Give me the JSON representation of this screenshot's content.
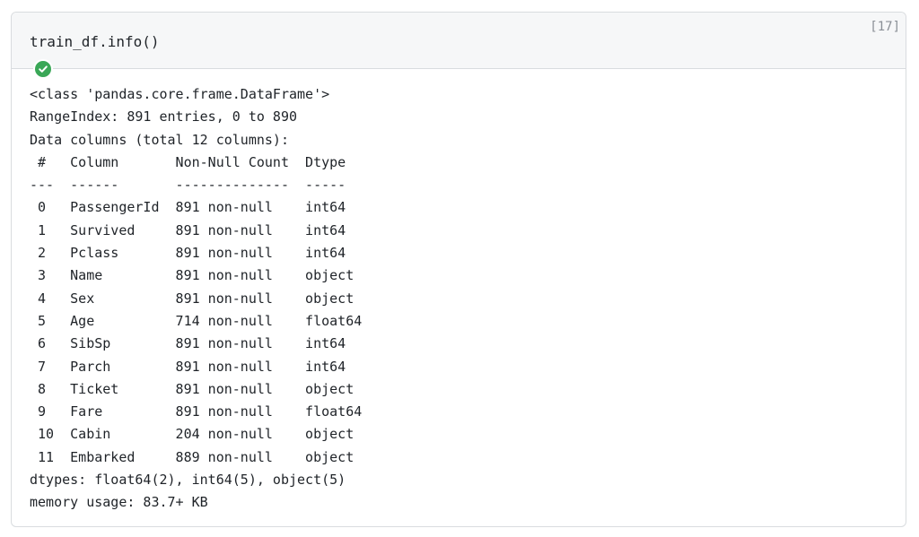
{
  "cell": {
    "execution_count": "[17]",
    "code": "train_df.info()",
    "status": "success",
    "status_icon": "check-circle-icon",
    "status_color": "#3aa757"
  },
  "output": {
    "lines": [
      "<class 'pandas.core.frame.DataFrame'>",
      "RangeIndex: 891 entries, 0 to 890",
      "Data columns (total 12 columns):",
      " #   Column       Non-Null Count  Dtype  ",
      "---  ------       --------------  -----  ",
      " 0   PassengerId  891 non-null    int64  ",
      " 1   Survived     891 non-null    int64  ",
      " 2   Pclass       891 non-null    int64  ",
      " 3   Name         891 non-null    object ",
      " 4   Sex          891 non-null    object ",
      " 5   Age          714 non-null    float64",
      " 6   SibSp        891 non-null    int64  ",
      " 7   Parch        891 non-null    int64  ",
      " 8   Ticket       891 non-null    object ",
      " 9   Fare         891 non-null    float64",
      " 10  Cabin        204 non-null    object ",
      " 11  Embarked     889 non-null    object ",
      "dtypes: float64(2), int64(5), object(5)",
      "memory usage: 83.7+ KB"
    ]
  }
}
